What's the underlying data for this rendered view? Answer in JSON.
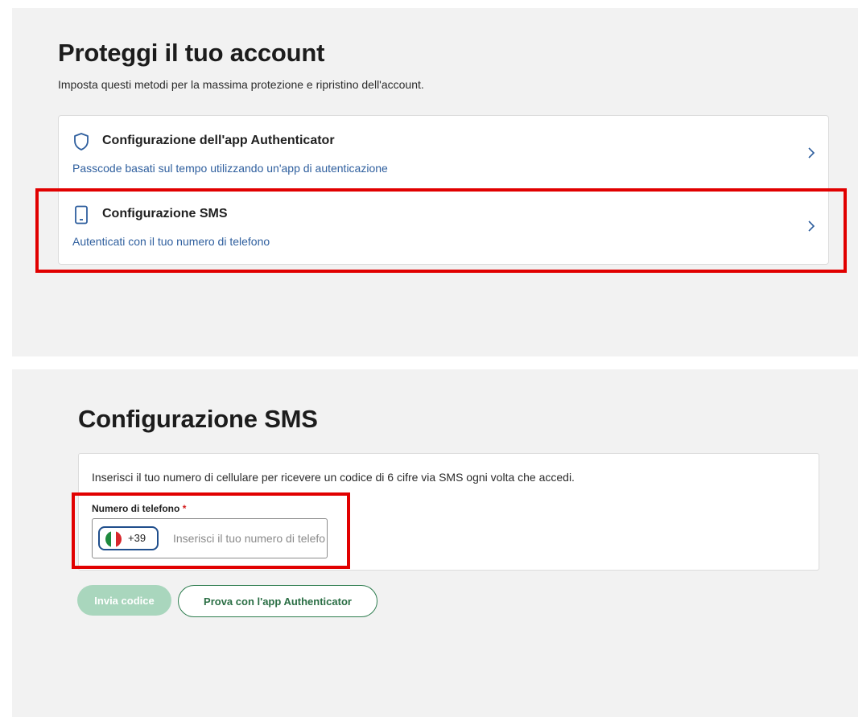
{
  "protect": {
    "title": "Proteggi il tuo account",
    "subtitle": "Imposta questi metodi per la massima protezione e ripristino dell'account.",
    "methods": [
      {
        "icon": "shield-icon",
        "title": "Configurazione dell'app Authenticator",
        "description": "Passcode basati sul tempo utilizzando un'app di autenticazione"
      },
      {
        "icon": "phone-icon",
        "title": "Configurazione SMS",
        "description": "Autenticati con il tuo numero di telefono"
      }
    ]
  },
  "sms": {
    "title": "Configurazione SMS",
    "description": "Inserisci il tuo numero di cellulare per ricevere un codice di 6 cifre via SMS ogni volta che accedi.",
    "phone_label": "Numero di telefono",
    "required_mark": "*",
    "country_flag": "flag-italy-icon",
    "dial_code": "+39",
    "phone_value": "",
    "phone_placeholder": "Inserisci il tuo numero di telefono",
    "send_button": "Invia codice",
    "alt_button": "Prova con l'app Authenticator"
  },
  "colors": {
    "highlight": "#e10000",
    "link_blue": "#2f5f9e",
    "brand_green": "#2e7d4f",
    "disabled_green": "#a9d6bd"
  }
}
